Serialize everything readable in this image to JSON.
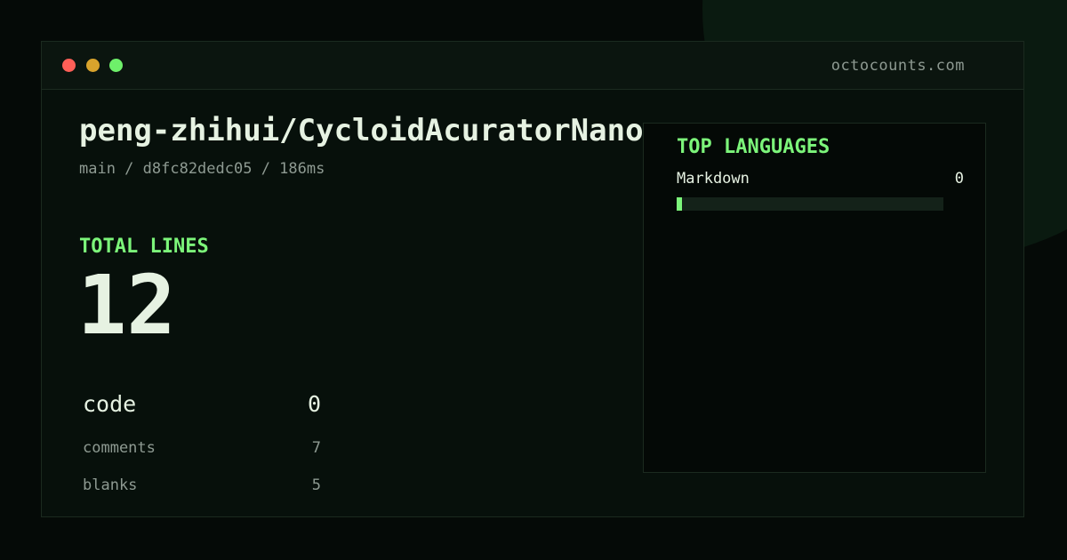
{
  "window": {
    "site": "octocounts.com",
    "controls": [
      "close",
      "minimize",
      "maximize"
    ]
  },
  "repo": {
    "title": "peng-zhihui/CycloidAcuratorNano",
    "meta": "main / d8fc82dedc05 / 186ms"
  },
  "totals": {
    "label": "TOTAL LINES",
    "value": "12"
  },
  "stats": [
    {
      "label": "code",
      "value": "0"
    },
    {
      "label": "comments",
      "value": "7"
    },
    {
      "label": "blanks",
      "value": "5"
    }
  ],
  "languages": {
    "heading": "TOP LANGUAGES",
    "items": [
      {
        "name": "Markdown",
        "count": "0",
        "fraction": 0.02
      }
    ]
  },
  "colors": {
    "accent": "#7cf57a",
    "text": "#e6f2e2",
    "muted": "#8e9a92",
    "close": "#ff5f57",
    "minimize": "#d9a32c",
    "maximize": "#6ef06a"
  }
}
